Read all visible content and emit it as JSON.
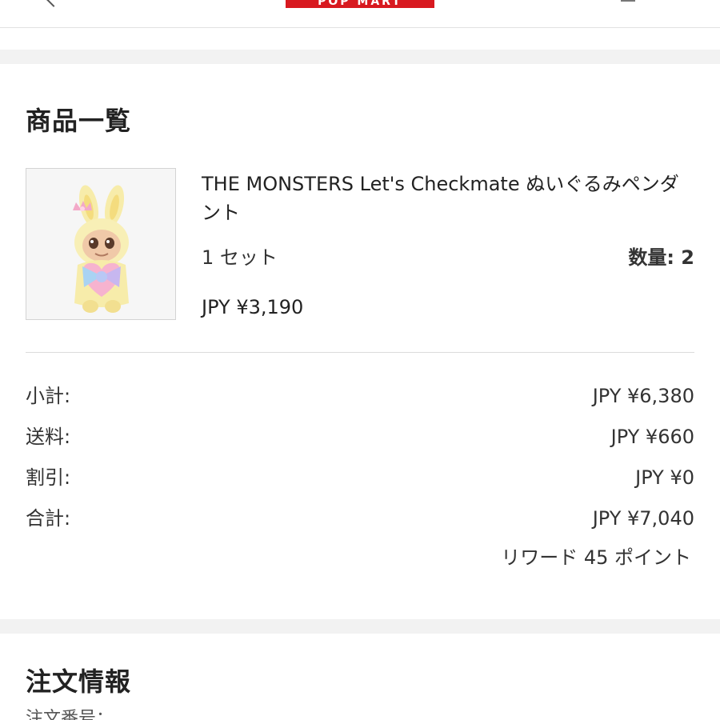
{
  "header": {
    "brand": "POP MART"
  },
  "products_section": {
    "title": "商品一覧",
    "items": [
      {
        "name": "THE MONSTERS Let's Checkmate ぬいぐるみペンダント",
        "variant": "1 セット",
        "quantity": "数量: 2",
        "price": "JPY ¥3,190"
      }
    ]
  },
  "summary": {
    "rows": [
      {
        "label": "小計:",
        "value": "JPY ¥6,380"
      },
      {
        "label": "送料:",
        "value": "JPY ¥660"
      },
      {
        "label": "割引:",
        "value": "JPY ¥0"
      },
      {
        "label": "合計:",
        "value": "JPY ¥7,040"
      }
    ],
    "reward": "リワード 45 ポイント"
  },
  "order_section": {
    "title": "注文情報",
    "order_number_label": "注文番号："
  },
  "colors": {
    "brand_red": "#d8191f",
    "section_gap": "#f2f2f2",
    "divider": "#dcdcdc"
  }
}
